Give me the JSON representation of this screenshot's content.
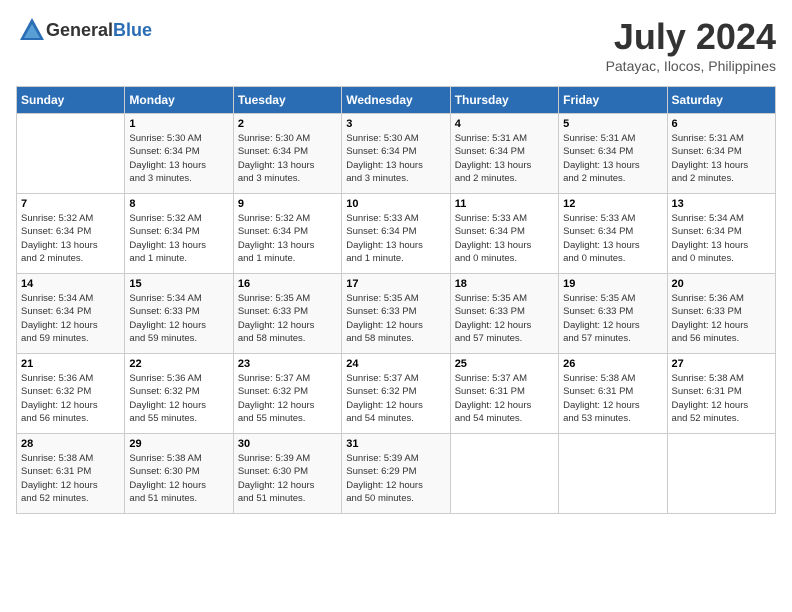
{
  "header": {
    "logo_general": "General",
    "logo_blue": "Blue",
    "month_year": "July 2024",
    "location": "Patayac, Ilocos, Philippines"
  },
  "days_of_week": [
    "Sunday",
    "Monday",
    "Tuesday",
    "Wednesday",
    "Thursday",
    "Friday",
    "Saturday"
  ],
  "weeks": [
    [
      {
        "day": "",
        "info": ""
      },
      {
        "day": "1",
        "info": "Sunrise: 5:30 AM\nSunset: 6:34 PM\nDaylight: 13 hours\nand 3 minutes."
      },
      {
        "day": "2",
        "info": "Sunrise: 5:30 AM\nSunset: 6:34 PM\nDaylight: 13 hours\nand 3 minutes."
      },
      {
        "day": "3",
        "info": "Sunrise: 5:30 AM\nSunset: 6:34 PM\nDaylight: 13 hours\nand 3 minutes."
      },
      {
        "day": "4",
        "info": "Sunrise: 5:31 AM\nSunset: 6:34 PM\nDaylight: 13 hours\nand 2 minutes."
      },
      {
        "day": "5",
        "info": "Sunrise: 5:31 AM\nSunset: 6:34 PM\nDaylight: 13 hours\nand 2 minutes."
      },
      {
        "day": "6",
        "info": "Sunrise: 5:31 AM\nSunset: 6:34 PM\nDaylight: 13 hours\nand 2 minutes."
      }
    ],
    [
      {
        "day": "7",
        "info": "Sunrise: 5:32 AM\nSunset: 6:34 PM\nDaylight: 13 hours\nand 2 minutes."
      },
      {
        "day": "8",
        "info": "Sunrise: 5:32 AM\nSunset: 6:34 PM\nDaylight: 13 hours\nand 1 minute."
      },
      {
        "day": "9",
        "info": "Sunrise: 5:32 AM\nSunset: 6:34 PM\nDaylight: 13 hours\nand 1 minute."
      },
      {
        "day": "10",
        "info": "Sunrise: 5:33 AM\nSunset: 6:34 PM\nDaylight: 13 hours\nand 1 minute."
      },
      {
        "day": "11",
        "info": "Sunrise: 5:33 AM\nSunset: 6:34 PM\nDaylight: 13 hours\nand 0 minutes."
      },
      {
        "day": "12",
        "info": "Sunrise: 5:33 AM\nSunset: 6:34 PM\nDaylight: 13 hours\nand 0 minutes."
      },
      {
        "day": "13",
        "info": "Sunrise: 5:34 AM\nSunset: 6:34 PM\nDaylight: 13 hours\nand 0 minutes."
      }
    ],
    [
      {
        "day": "14",
        "info": "Sunrise: 5:34 AM\nSunset: 6:34 PM\nDaylight: 12 hours\nand 59 minutes."
      },
      {
        "day": "15",
        "info": "Sunrise: 5:34 AM\nSunset: 6:33 PM\nDaylight: 12 hours\nand 59 minutes."
      },
      {
        "day": "16",
        "info": "Sunrise: 5:35 AM\nSunset: 6:33 PM\nDaylight: 12 hours\nand 58 minutes."
      },
      {
        "day": "17",
        "info": "Sunrise: 5:35 AM\nSunset: 6:33 PM\nDaylight: 12 hours\nand 58 minutes."
      },
      {
        "day": "18",
        "info": "Sunrise: 5:35 AM\nSunset: 6:33 PM\nDaylight: 12 hours\nand 57 minutes."
      },
      {
        "day": "19",
        "info": "Sunrise: 5:35 AM\nSunset: 6:33 PM\nDaylight: 12 hours\nand 57 minutes."
      },
      {
        "day": "20",
        "info": "Sunrise: 5:36 AM\nSunset: 6:33 PM\nDaylight: 12 hours\nand 56 minutes."
      }
    ],
    [
      {
        "day": "21",
        "info": "Sunrise: 5:36 AM\nSunset: 6:32 PM\nDaylight: 12 hours\nand 56 minutes."
      },
      {
        "day": "22",
        "info": "Sunrise: 5:36 AM\nSunset: 6:32 PM\nDaylight: 12 hours\nand 55 minutes."
      },
      {
        "day": "23",
        "info": "Sunrise: 5:37 AM\nSunset: 6:32 PM\nDaylight: 12 hours\nand 55 minutes."
      },
      {
        "day": "24",
        "info": "Sunrise: 5:37 AM\nSunset: 6:32 PM\nDaylight: 12 hours\nand 54 minutes."
      },
      {
        "day": "25",
        "info": "Sunrise: 5:37 AM\nSunset: 6:31 PM\nDaylight: 12 hours\nand 54 minutes."
      },
      {
        "day": "26",
        "info": "Sunrise: 5:38 AM\nSunset: 6:31 PM\nDaylight: 12 hours\nand 53 minutes."
      },
      {
        "day": "27",
        "info": "Sunrise: 5:38 AM\nSunset: 6:31 PM\nDaylight: 12 hours\nand 52 minutes."
      }
    ],
    [
      {
        "day": "28",
        "info": "Sunrise: 5:38 AM\nSunset: 6:31 PM\nDaylight: 12 hours\nand 52 minutes."
      },
      {
        "day": "29",
        "info": "Sunrise: 5:38 AM\nSunset: 6:30 PM\nDaylight: 12 hours\nand 51 minutes."
      },
      {
        "day": "30",
        "info": "Sunrise: 5:39 AM\nSunset: 6:30 PM\nDaylight: 12 hours\nand 51 minutes."
      },
      {
        "day": "31",
        "info": "Sunrise: 5:39 AM\nSunset: 6:29 PM\nDaylight: 12 hours\nand 50 minutes."
      },
      {
        "day": "",
        "info": ""
      },
      {
        "day": "",
        "info": ""
      },
      {
        "day": "",
        "info": ""
      }
    ]
  ]
}
